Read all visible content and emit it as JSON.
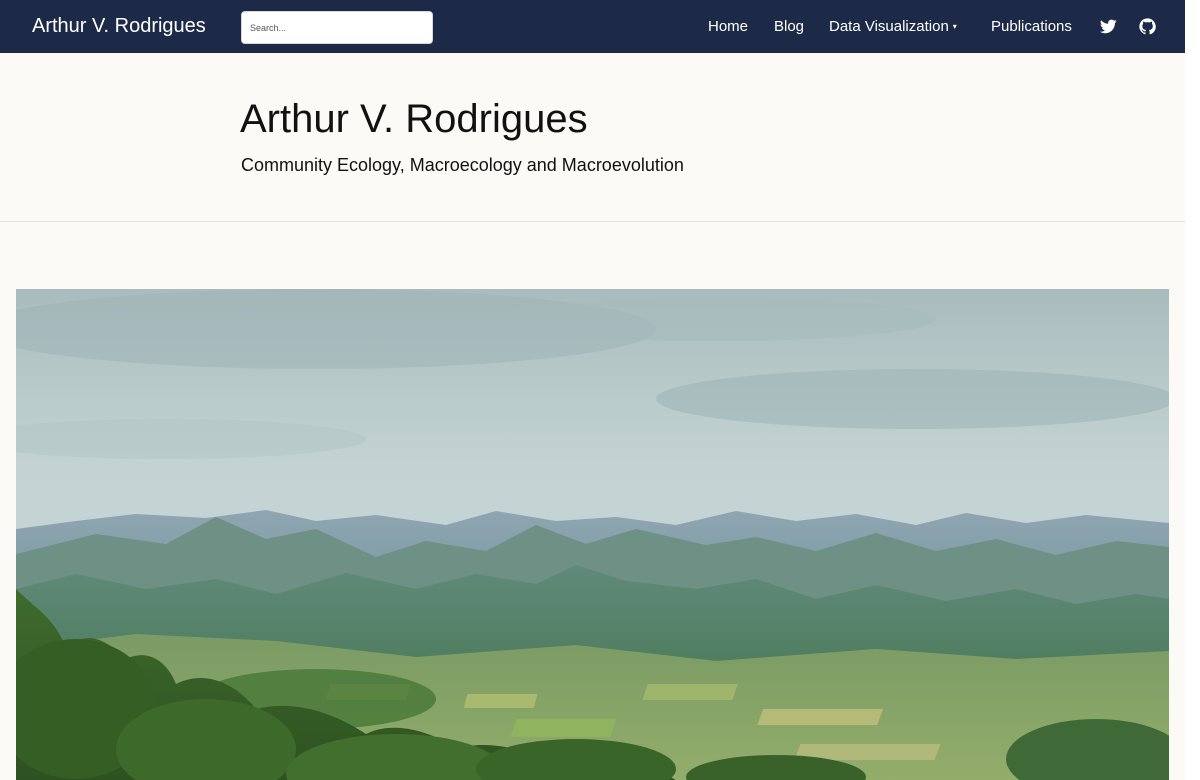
{
  "nav": {
    "brand": "Arthur V. Rodrigues",
    "search_placeholder": "Search...",
    "links": {
      "home": "Home",
      "blog": "Blog",
      "data_viz": "Data Visualization",
      "publications": "Publications"
    },
    "dropdown_indicator": "▾",
    "icons": [
      "twitter-icon",
      "github-icon"
    ]
  },
  "header": {
    "title": "Arthur V. Rodrigues",
    "subtitle": "Community Ecology, Macroecology and Macroevolution"
  },
  "colors": {
    "navbar_bg": "#1c2a48",
    "page_bg": "#fbfaf6",
    "text": "#111111"
  }
}
